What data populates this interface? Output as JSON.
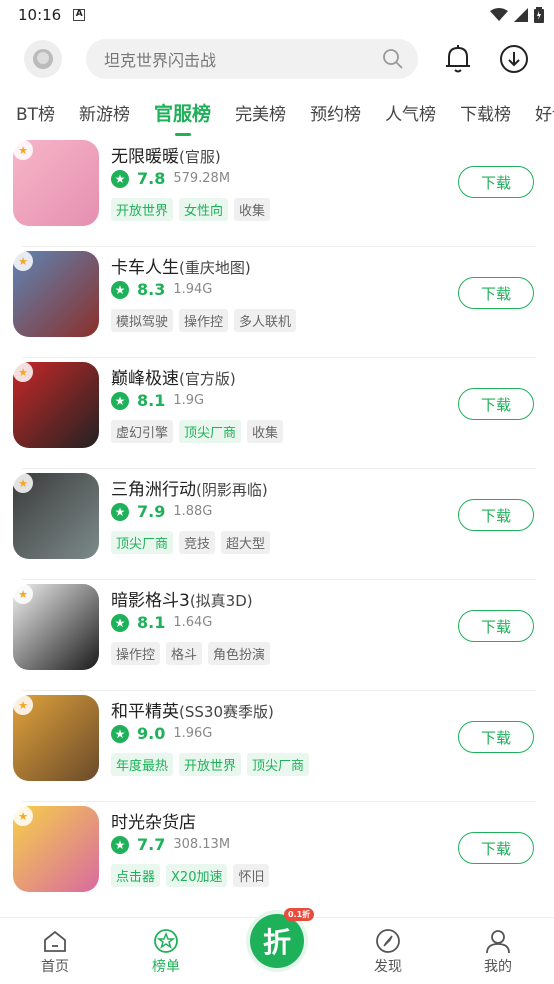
{
  "status": {
    "time": "10:16"
  },
  "header": {
    "search_placeholder": "坦克世界闪击战"
  },
  "tabs": [
    {
      "label": "BT榜",
      "active": false
    },
    {
      "label": "新游榜",
      "active": false
    },
    {
      "label": "官服榜",
      "active": true
    },
    {
      "label": "完美榜",
      "active": false
    },
    {
      "label": "预约榜",
      "active": false
    },
    {
      "label": "人气榜",
      "active": false
    },
    {
      "label": "下载榜",
      "active": false
    },
    {
      "label": "好评",
      "active": false
    }
  ],
  "games": [
    {
      "name": "无限暖暖",
      "suffix": "(官服)",
      "rating": "7.8",
      "size": "579.28M",
      "tags": [
        {
          "text": "开放世界",
          "green": true
        },
        {
          "text": "女性向",
          "green": true
        },
        {
          "text": "收集",
          "green": false
        }
      ],
      "icon_colors": [
        "#f7b6c8",
        "#e58fb0"
      ],
      "download_label": "下载"
    },
    {
      "name": "卡车人生",
      "suffix": "(重庆地图)",
      "rating": "8.3",
      "size": "1.94G",
      "tags": [
        {
          "text": "模拟驾驶",
          "green": false
        },
        {
          "text": "操作控",
          "green": false
        },
        {
          "text": "多人联机",
          "green": false
        }
      ],
      "icon_colors": [
        "#5e86b5",
        "#8b2f2a"
      ],
      "download_label": "下载"
    },
    {
      "name": "巅峰极速",
      "suffix": "(官方版)",
      "rating": "8.1",
      "size": "1.9G",
      "tags": [
        {
          "text": "虚幻引擎",
          "green": false
        },
        {
          "text": "顶尖厂商",
          "green": true
        },
        {
          "text": "收集",
          "green": false
        }
      ],
      "icon_colors": [
        "#c62828",
        "#222222"
      ],
      "download_label": "下载"
    },
    {
      "name": "三角洲行动",
      "suffix": "(阴影再临)",
      "rating": "7.9",
      "size": "1.88G",
      "tags": [
        {
          "text": "顶尖厂商",
          "green": true
        },
        {
          "text": "竞技",
          "green": false
        },
        {
          "text": "超大型",
          "green": false
        }
      ],
      "icon_colors": [
        "#3b3b3b",
        "#7d8b8b"
      ],
      "download_label": "下载"
    },
    {
      "name": "暗影格斗3",
      "suffix": "(拟真3D)",
      "rating": "8.1",
      "size": "1.64G",
      "tags": [
        {
          "text": "操作控",
          "green": false
        },
        {
          "text": "格斗",
          "green": false
        },
        {
          "text": "角色扮演",
          "green": false
        }
      ],
      "icon_colors": [
        "#f0f0f0",
        "#1a1a1a"
      ],
      "download_label": "下载"
    },
    {
      "name": "和平精英",
      "suffix": "(SS30赛季版)",
      "rating": "9.0",
      "size": "1.96G",
      "tags": [
        {
          "text": "年度最热",
          "green": true
        },
        {
          "text": "开放世界",
          "green": true
        },
        {
          "text": "顶尖厂商",
          "green": true
        }
      ],
      "icon_colors": [
        "#e0a23b",
        "#6a4a2a"
      ],
      "download_label": "下载"
    },
    {
      "name": "时光杂货店",
      "suffix": "",
      "rating": "7.7",
      "size": "308.13M",
      "tags": [
        {
          "text": "点击器",
          "green": true
        },
        {
          "text": "X20加速",
          "green": true
        },
        {
          "text": "怀旧",
          "green": false
        }
      ],
      "icon_colors": [
        "#f5d04a",
        "#d96aa0"
      ],
      "download_label": "下载"
    }
  ],
  "nav": {
    "home": "首页",
    "rank": "榜单",
    "fab_text": "折",
    "fab_badge": "0.1折",
    "discover": "发现",
    "mine": "我的"
  },
  "colors": {
    "accent": "#1fb15a"
  }
}
